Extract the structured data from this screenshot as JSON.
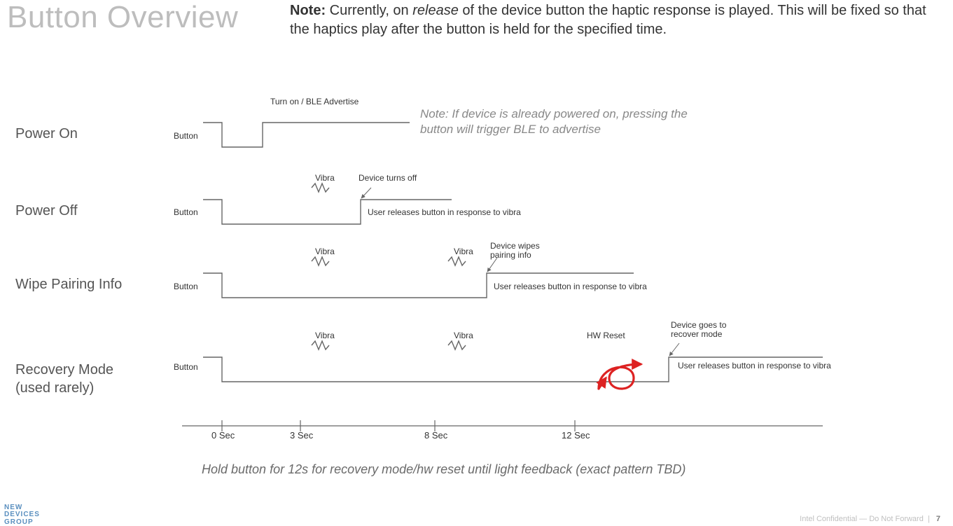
{
  "title": "Button Overview",
  "top_note_strong": "Note:",
  "top_note_rest_1": " Currently, on ",
  "top_note_italic": "release",
  "top_note_rest_2": " of the device button the haptic response is played. This will be fixed so that the haptics play after the button is held for the specified time.",
  "rows": {
    "power_on": {
      "label": "Power On",
      "button": "Button"
    },
    "power_off": {
      "label": "Power Off",
      "button": "Button"
    },
    "wipe": {
      "label": "Wipe Pairing Info",
      "button": "Button"
    },
    "recovery": {
      "label": "Recovery Mode (used rarely)",
      "button": "Button"
    }
  },
  "annotations": {
    "turn_on": "Turn on / BLE Advertise",
    "power_on_note": "Note: If device is already powered on, pressing the button will trigger BLE to advertise",
    "vibra": "Vibra",
    "device_off": "Device turns off",
    "release_vibra": "User releases button in response to vibra",
    "device_wipes": "Device wipes pairing info",
    "hw_reset": "HW Reset",
    "device_recover": "Device goes to recover mode"
  },
  "ticks": {
    "t0": "0 Sec",
    "t3": "3 Sec",
    "t8": "8 Sec",
    "t12": "12 Sec"
  },
  "hold_note": "Hold button for 12s for recovery mode/hw reset until light feedback (exact pattern TBD)",
  "footer": {
    "conf": "Intel Confidential — Do Not Forward",
    "sep": "|",
    "page": "7"
  },
  "logo": {
    "l1": "NEW",
    "l2": "DEVICES",
    "l3": "GROUP"
  },
  "chart_data": {
    "type": "timing-diagram",
    "time_axis_seconds": [
      0,
      3,
      8,
      12
    ],
    "signals": [
      {
        "name": "Power On",
        "press_at_s": 0,
        "release_at_s": 1,
        "events": [
          {
            "at_s": 1,
            "label": "Turn on / BLE Advertise"
          }
        ]
      },
      {
        "name": "Power Off",
        "press_at_s": 0,
        "release_at_s": 4,
        "events": [
          {
            "at_s": 3,
            "label": "Vibra"
          },
          {
            "at_s": 4,
            "label": "Device turns off"
          }
        ]
      },
      {
        "name": "Wipe Pairing Info",
        "press_at_s": 0,
        "release_at_s": 8.5,
        "events": [
          {
            "at_s": 3,
            "label": "Vibra"
          },
          {
            "at_s": 8,
            "label": "Vibra"
          },
          {
            "at_s": 8.5,
            "label": "Device wipes pairing info"
          }
        ]
      },
      {
        "name": "Recovery Mode",
        "press_at_s": 0,
        "release_at_s": 14,
        "events": [
          {
            "at_s": 3,
            "label": "Vibra"
          },
          {
            "at_s": 8,
            "label": "Vibra"
          },
          {
            "at_s": 12,
            "label": "HW Reset"
          },
          {
            "at_s": 14,
            "label": "Device goes to recover mode"
          }
        ]
      }
    ],
    "notes": [
      "If device is already powered on, pressing the button will trigger BLE to advertise",
      "Hold button for 12s for recovery mode/hw reset until light feedback (exact pattern TBD)"
    ]
  }
}
